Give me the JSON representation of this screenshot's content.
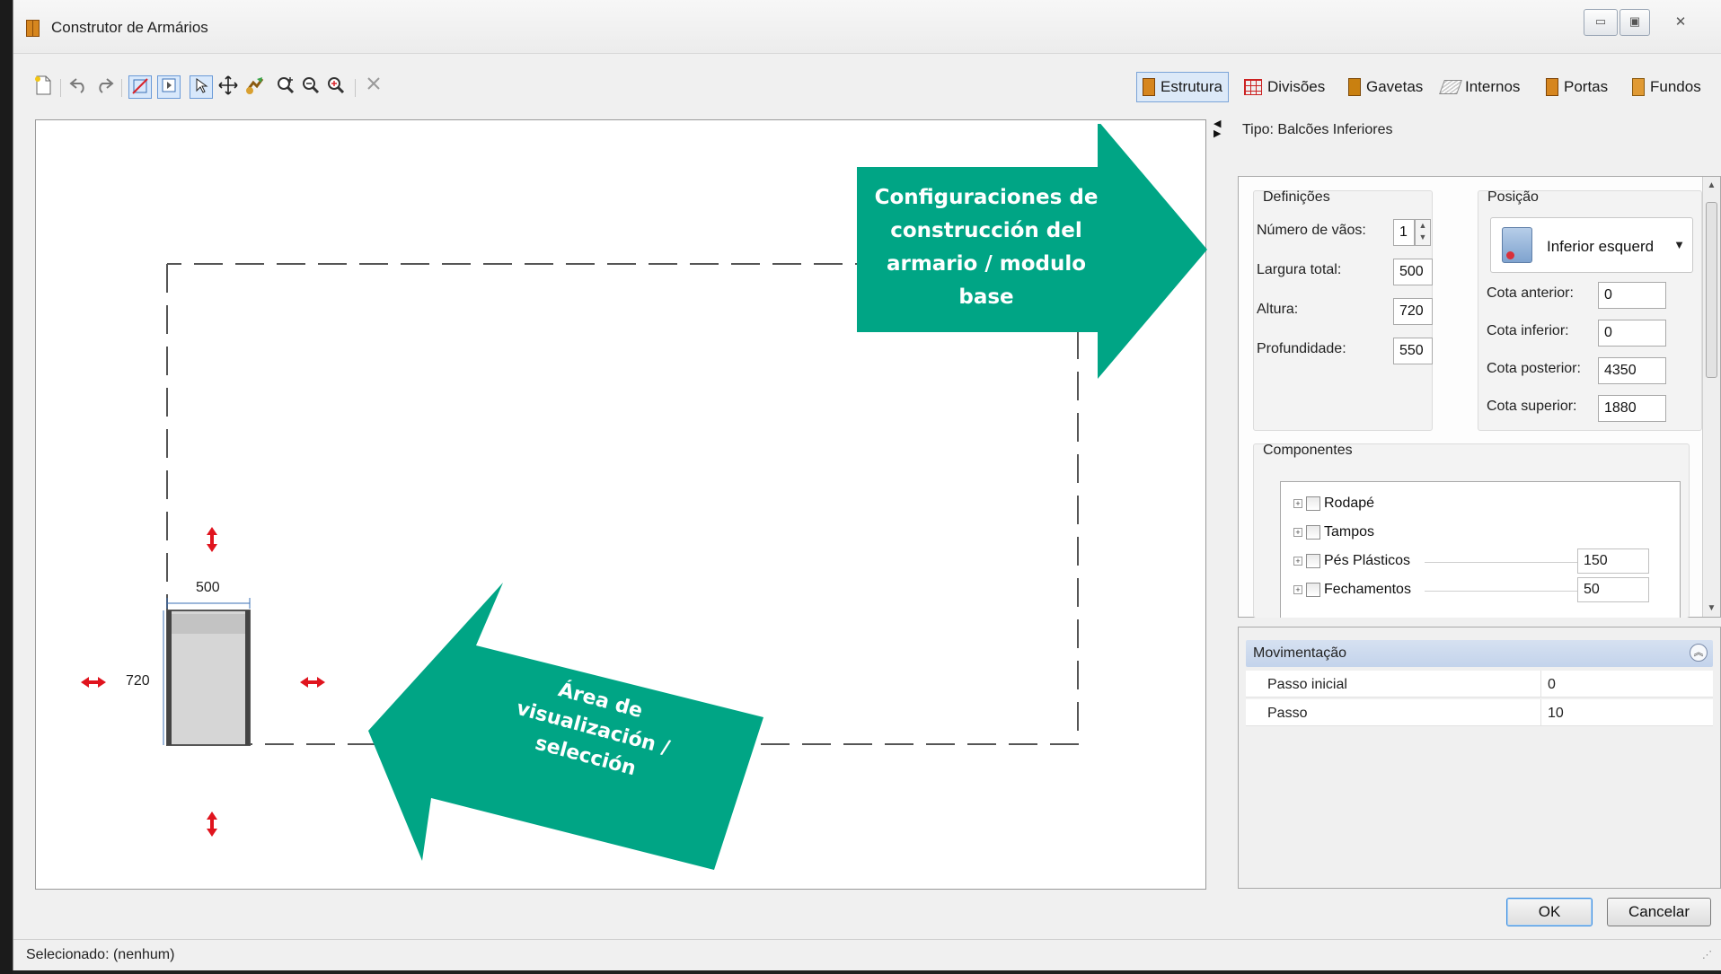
{
  "window": {
    "title": "Construtor de Armários",
    "minimize_label": "▭",
    "maximize_label": "▣",
    "close_label": "✕"
  },
  "toolbar": {
    "tools": [
      "new-icon",
      "undo-icon",
      "redo-icon",
      "snap-icon",
      "frame-icon",
      "select-icon",
      "move-icon",
      "rotate-icon",
      "zoom-region-icon",
      "zoom-out-icon",
      "zoom-fit-icon",
      "delete-icon"
    ],
    "tabs": [
      {
        "label": "Estrutura",
        "icon": "structure-icon"
      },
      {
        "label": "Divisões",
        "icon": "divisions-icon"
      },
      {
        "label": "Gavetas",
        "icon": "drawers-icon"
      },
      {
        "label": "Internos",
        "icon": "internals-icon"
      },
      {
        "label": "Portas",
        "icon": "doors-icon"
      },
      {
        "label": "Fundos",
        "icon": "backs-icon"
      }
    ],
    "active_tab": "Estrutura"
  },
  "canvas": {
    "width_label": "500",
    "height_label": "720",
    "callout_text": "Área de visualización / selección",
    "resize_color": "#e0141e"
  },
  "config": {
    "tipo": "Tipo: Balcões Inferiores",
    "callout_text": "Configuraciones de construcción del armario / modulo base",
    "callout_color": "#00a585",
    "definicoes": {
      "title": "Definições",
      "vaos_label": "Número de vãos:",
      "vaos_value": "1",
      "largura_label": "Largura total:",
      "largura_value": "500",
      "altura_label": "Altura:",
      "altura_value": "720",
      "profundidade_label": "Profundidade:",
      "profundidade_value": "550"
    },
    "posicao": {
      "title": "Posição",
      "selected": "Inferior esquerd",
      "cota_anterior_label": "Cota anterior:",
      "cota_anterior_value": "0",
      "cota_inferior_label": "Cota inferior:",
      "cota_inferior_value": "0",
      "cota_posterior_label": "Cota posterior:",
      "cota_posterior_value": "4350",
      "cota_superior_label": "Cota superior:",
      "cota_superior_value": "1880"
    },
    "componentes": {
      "title": "Componentes",
      "items": [
        {
          "label": "Rodapé",
          "value": ""
        },
        {
          "label": "Tampos",
          "value": ""
        },
        {
          "label": "Pés Plásticos",
          "value": "150"
        },
        {
          "label": "Fechamentos",
          "value": "50"
        }
      ]
    }
  },
  "movimentacao": {
    "title": "Movimentação",
    "rows": [
      {
        "name": "Passo inicial",
        "value": "0"
      },
      {
        "name": "Passo",
        "value": "10"
      }
    ]
  },
  "buttons": {
    "ok": "OK",
    "cancel": "Cancelar"
  },
  "status": {
    "text": "Selecionado: (nenhum)"
  }
}
